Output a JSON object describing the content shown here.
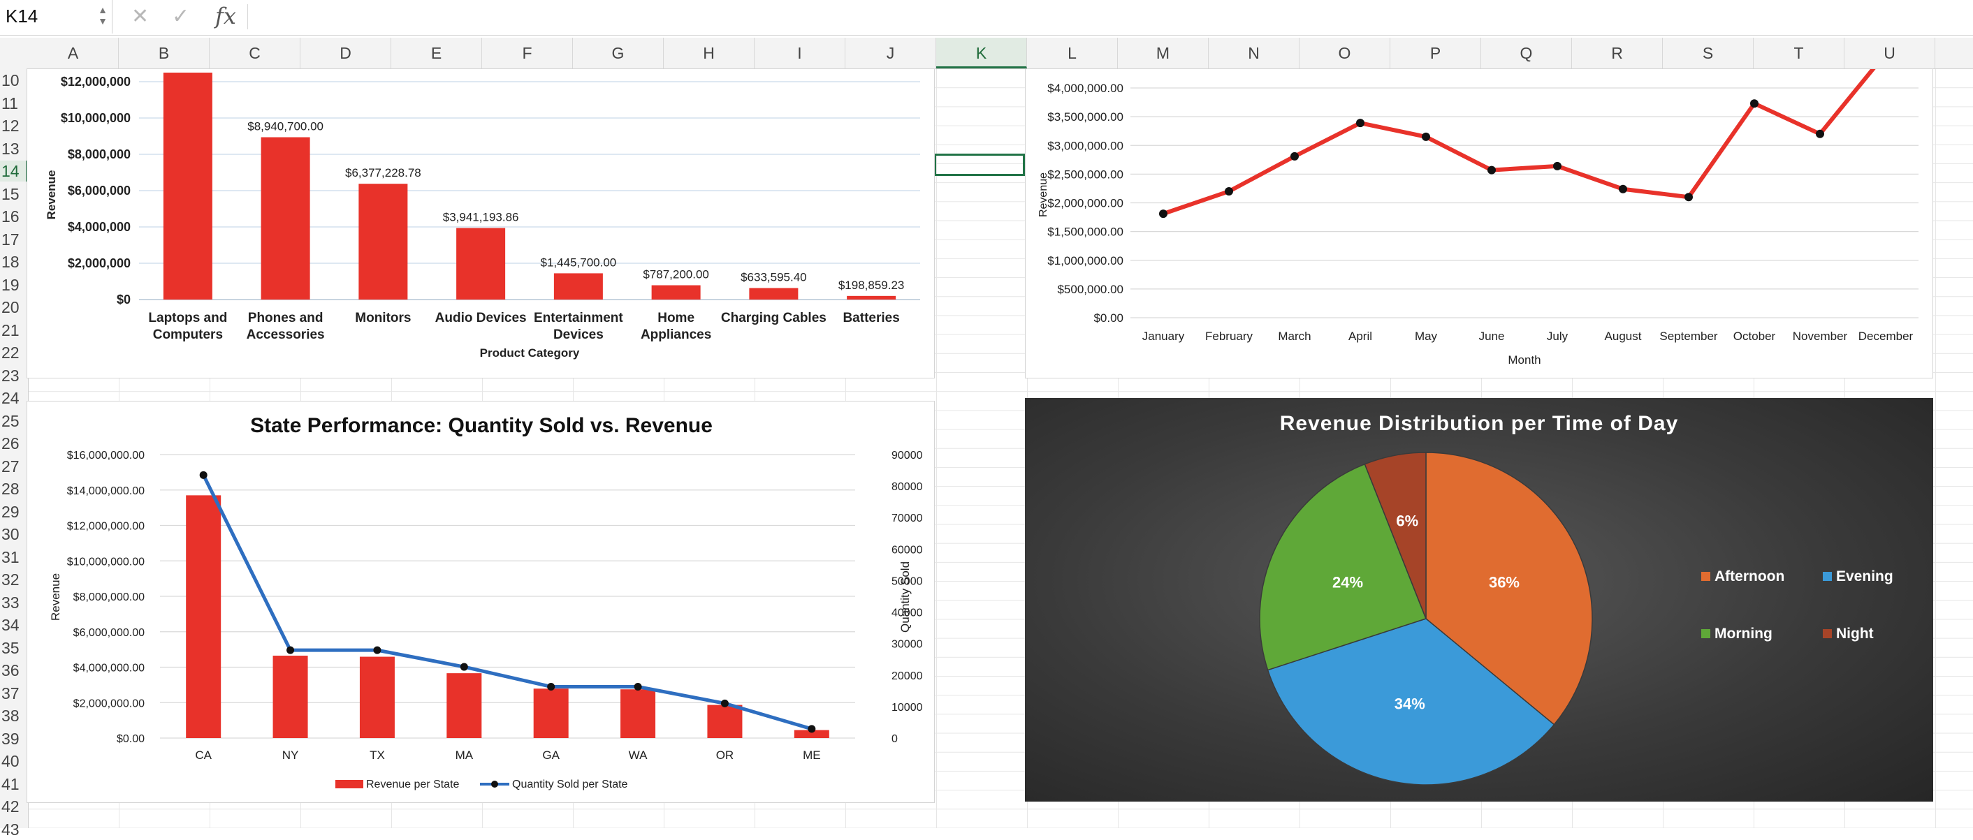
{
  "formula_bar": {
    "cell_ref": "K14",
    "fx_label": "fx",
    "cancel_glyph": "✕",
    "enter_glyph": "✓",
    "formula": ""
  },
  "sheet": {
    "columns": [
      "A",
      "B",
      "C",
      "D",
      "E",
      "F",
      "G",
      "H",
      "I",
      "J",
      "K",
      "L",
      "M",
      "N",
      "O",
      "P",
      "Q",
      "R",
      "S",
      "T",
      "U"
    ],
    "active_column": "K",
    "rows": [
      "10",
      "11",
      "12",
      "13",
      "14",
      "15",
      "16",
      "17",
      "18",
      "19",
      "20",
      "21",
      "22",
      "23",
      "24",
      "25",
      "26",
      "27",
      "28",
      "29",
      "30",
      "31",
      "32",
      "33",
      "34",
      "35",
      "36",
      "37",
      "38",
      "39",
      "40",
      "41",
      "42",
      "43"
    ],
    "active_row": "14",
    "selection_color": "#217346"
  },
  "chart_data": [
    {
      "id": "product-category-revenue",
      "type": "bar",
      "title": "",
      "xlabel": "Product Category",
      "ylabel": "Revenue",
      "categories": [
        "Laptops and Computers",
        "Phones and Accessories",
        "Monitors",
        "Audio Devices",
        "Entertainment Devices",
        "Home Appliances",
        "Charging Cables",
        "Batteries"
      ],
      "values": [
        12500000,
        8940700.0,
        6377228.78,
        3941193.86,
        1445700.0,
        787200.0,
        633595.4,
        198859.23
      ],
      "data_labels": [
        "",
        "$8,940,700.00",
        "$6,377,228.78",
        "$3,941,193.86",
        "$1,445,700.00",
        "$787,200.00",
        "$633,595.40",
        "$198,859.23"
      ],
      "y_ticks": [
        "$0",
        "$2,000,000",
        "$4,000,000",
        "$6,000,000",
        "$8,000,000",
        "$10,000,000",
        "$12,000,000"
      ],
      "ylim": [
        0,
        12000000
      ],
      "color": "#e8322a",
      "grid": true
    },
    {
      "id": "monthly-revenue",
      "type": "line",
      "title": "",
      "xlabel": "Month",
      "ylabel": "Revenue",
      "categories": [
        "January",
        "February",
        "March",
        "April",
        "May",
        "June",
        "July",
        "August",
        "September",
        "October",
        "November",
        "December"
      ],
      "values": [
        1810000,
        2200000,
        2810000,
        3390000,
        3150000,
        2570000,
        2640000,
        2240000,
        2100000,
        3730000,
        3200000,
        4600000
      ],
      "y_ticks": [
        "$0.00",
        "$500,000.00",
        "$1,000,000.00",
        "$1,500,000.00",
        "$2,000,000.00",
        "$2,500,000.00",
        "$3,000,000.00",
        "$3,500,000.00",
        "$4,000,000.00"
      ],
      "ylim": [
        0,
        4400000
      ],
      "color": "#e8322a",
      "grid": true
    },
    {
      "id": "state-performance",
      "type": "bar",
      "title": "State Performance: Quantity Sold vs. Revenue",
      "xlabel": "",
      "ylabel": "Revenue",
      "y2label": "Quantity Sold",
      "categories": [
        "CA",
        "NY",
        "TX",
        "MA",
        "GA",
        "WA",
        "OR",
        "ME"
      ],
      "series": [
        {
          "name": "Revenue per State",
          "type": "bar",
          "axis": "left",
          "color": "#e8322a",
          "values": [
            13700000,
            4650000,
            4590000,
            3660000,
            2790000,
            2750000,
            1870000,
            450000
          ]
        },
        {
          "name": "Quantity Sold per State",
          "type": "line",
          "axis": "right",
          "color": "#2e6ec0",
          "values": [
            83500,
            27900,
            27900,
            22600,
            16300,
            16300,
            11000,
            2900
          ]
        }
      ],
      "y_ticks": [
        "$0.00",
        "$2,000,000.00",
        "$4,000,000.00",
        "$6,000,000.00",
        "$8,000,000.00",
        "$10,000,000.00",
        "$12,000,000.00",
        "$14,000,000.00",
        "$16,000,000.00"
      ],
      "y2_ticks": [
        "0",
        "10000",
        "20000",
        "30000",
        "40000",
        "50000",
        "60000",
        "70000",
        "80000",
        "90000"
      ],
      "ylim": [
        0,
        16000000
      ],
      "y2lim": [
        0,
        90000
      ],
      "legend": "bottom",
      "grid": true
    },
    {
      "id": "time-of-day-revenue",
      "type": "pie",
      "title": "Revenue Distribution per Time of Day",
      "slices": [
        {
          "name": "Afternoon",
          "value": 36,
          "label": "36%",
          "color": "#e06c30"
        },
        {
          "name": "Evening",
          "value": 34,
          "label": "34%",
          "color": "#3b9ad9"
        },
        {
          "name": "Morning",
          "value": 24,
          "label": "24%",
          "color": "#5fa838"
        },
        {
          "name": "Night",
          "value": 6,
          "label": "6%",
          "color": "#a64428"
        }
      ],
      "legend": "right"
    }
  ]
}
